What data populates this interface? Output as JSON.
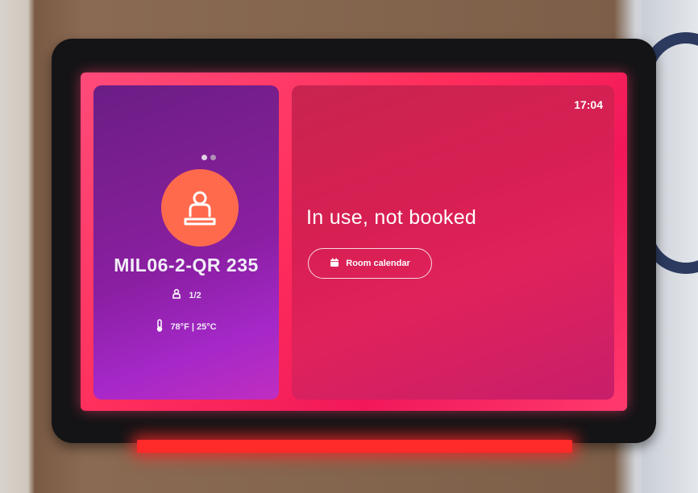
{
  "clock": "17:04",
  "room": {
    "name": "MIL06-2-QR 235",
    "occupancy": "1/2",
    "temperature": "78°F | 25°C"
  },
  "status": {
    "text": "In use, not booked"
  },
  "actions": {
    "room_calendar_label": "Room calendar"
  },
  "pager": {
    "count": 2,
    "active": 1
  },
  "icons": {
    "avatar": "person-icon",
    "occupancy": "person-icon",
    "temperature": "thermometer-icon",
    "calendar": "calendar-icon"
  },
  "colors": {
    "avatar_bg": "#ff6a4d",
    "left_panel": "#7a1f8e",
    "right_panel": "#d81f53",
    "status_light": "#ff2a2a"
  }
}
